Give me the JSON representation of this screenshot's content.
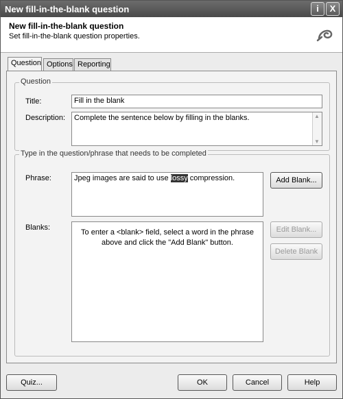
{
  "window": {
    "title": "New fill-in-the-blank question",
    "info_button": "i",
    "close_button": "X"
  },
  "header": {
    "title": "New fill-in-the-blank question",
    "subtitle": "Set fill-in-the-blank question properties."
  },
  "tabs": [
    {
      "label": "Question"
    },
    {
      "label": "Options"
    },
    {
      "label": "Reporting"
    }
  ],
  "question_group": {
    "legend": "Question",
    "title_label": "Title:",
    "title_value": "Fill in the blank",
    "description_label": "Description:",
    "description_value": "Complete the sentence below by filling in the blanks."
  },
  "phrase_group": {
    "legend": "Type in the question/phrase that needs to be completed",
    "phrase_label": "Phrase:",
    "phrase_before": "Jpeg images are said to use ",
    "phrase_selected": "lossy",
    "phrase_after": " compression.",
    "add_blank": "Add Blank...",
    "blanks_label": "Blanks:",
    "blanks_hint": "To enter a <blank> field, select a word in the phrase above and click the \"Add Blank\" button.",
    "edit_blank": "Edit Blank...",
    "delete_blank": "Delete Blank"
  },
  "footer": {
    "quiz": "Quiz...",
    "ok": "OK",
    "cancel": "Cancel",
    "help": "Help"
  }
}
